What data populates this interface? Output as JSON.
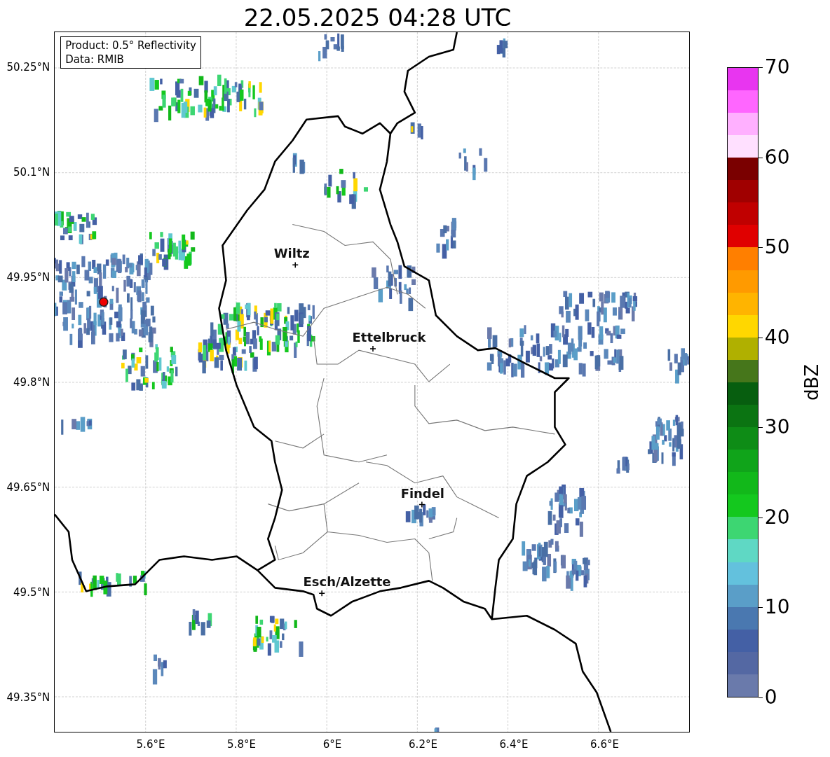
{
  "title": "22.05.2025 04:28 UTC",
  "info_box": [
    "Product: 0.5° Reflectivity",
    "Data: RMIB"
  ],
  "lat_ticks": [
    "50.25°N",
    "50.1°N",
    "49.95°N",
    "49.8°N",
    "49.65°N",
    "49.5°N",
    "49.35°N"
  ],
  "lon_ticks": [
    "5.6°E",
    "5.8°E",
    "6°E",
    "6.2°E",
    "6.4°E",
    "6.6°E"
  ],
  "cities": [
    {
      "name": "Wiltz"
    },
    {
      "name": "Ettelbruck"
    },
    {
      "name": "Findel"
    },
    {
      "name": "Esch/Alzette"
    }
  ],
  "colorbar": {
    "label": "dBZ",
    "ticks": [
      "70",
      "60",
      "50",
      "40",
      "30",
      "20",
      "10",
      "0"
    ],
    "bins": [
      {
        "color": "#6a7aab"
      },
      {
        "color": "#5468a3"
      },
      {
        "color": "#4460a5"
      },
      {
        "color": "#4a78b0"
      },
      {
        "color": "#5a9ec8"
      },
      {
        "color": "#63c1dd"
      },
      {
        "color": "#5fd8c4"
      },
      {
        "color": "#3dd672"
      },
      {
        "color": "#14c81e"
      },
      {
        "color": "#12b81a"
      },
      {
        "color": "#10a41a"
      },
      {
        "color": "#0e8c16"
      },
      {
        "color": "#0b7412"
      },
      {
        "color": "#075e0f"
      },
      {
        "color": "#46761b"
      },
      {
        "color": "#b0b000"
      },
      {
        "color": "#ffd700"
      },
      {
        "color": "#ffb400"
      },
      {
        "color": "#ff9a00"
      },
      {
        "color": "#ff7f00"
      },
      {
        "color": "#e00000"
      },
      {
        "color": "#c00000"
      },
      {
        "color": "#a00000"
      },
      {
        "color": "#7a0000"
      },
      {
        "color": "#ffe0ff"
      },
      {
        "color": "#ffb0ff"
      },
      {
        "color": "#ff66ff"
      },
      {
        "color": "#e835f0"
      }
    ]
  }
}
